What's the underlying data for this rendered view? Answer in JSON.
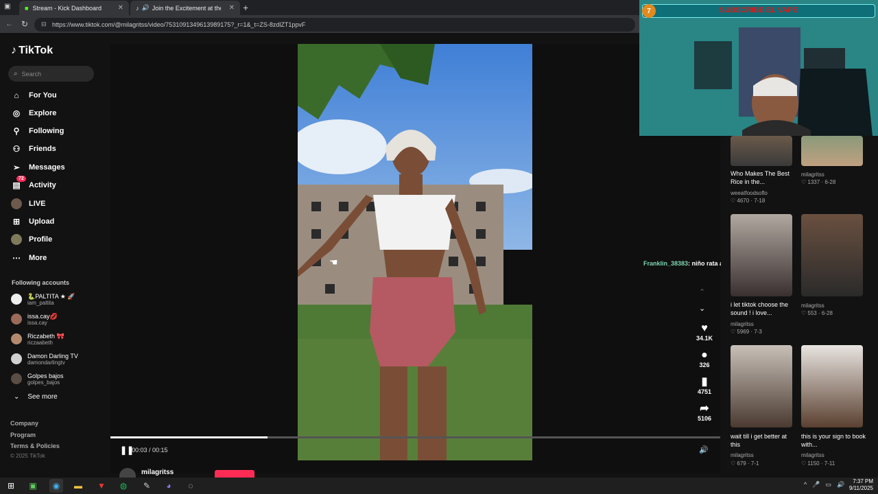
{
  "browser": {
    "tabs": [
      {
        "title": "Stream - Kick Dashboard"
      },
      {
        "title": "Join the Excitement at the D"
      }
    ],
    "url": "https://www.tiktok.com/@milagritss/video/7531091349613989175?_r=1&_t=ZS-8zdlZT1ppvF"
  },
  "sidebar": {
    "logo": "TikTok",
    "search_placeholder": "Search",
    "nav": [
      {
        "label": "For You",
        "icon": "home-icon"
      },
      {
        "label": "Explore",
        "icon": "compass-icon"
      },
      {
        "label": "Following",
        "icon": "following-icon"
      },
      {
        "label": "Friends",
        "icon": "friends-icon"
      },
      {
        "label": "Messages",
        "icon": "send-icon"
      },
      {
        "label": "Activity",
        "icon": "activity-icon",
        "badge": "72"
      },
      {
        "label": "LIVE",
        "icon": "live-icon"
      },
      {
        "label": "Upload",
        "icon": "upload-icon"
      },
      {
        "label": "Profile",
        "icon": "profile-icon"
      },
      {
        "label": "More",
        "icon": "more-icon"
      }
    ],
    "following_title": "Following accounts",
    "accounts": [
      {
        "name": "🐍PALTITA ★ 🚀",
        "handle": "iam_paltita"
      },
      {
        "name": "issa.cay💋",
        "handle": "issa.cay"
      },
      {
        "name": "Riczabeth 🎀",
        "handle": "riczaabeth"
      },
      {
        "name": "Damon Darling TV",
        "handle": "damondarlingtv"
      },
      {
        "name": "Golpes bajos",
        "handle": "golpes_bajos"
      }
    ],
    "see_more": "See more",
    "footer": [
      "Company",
      "Program",
      "Terms & Policies"
    ],
    "copyright": "© 2025 TikTok"
  },
  "player": {
    "time": "00:03 / 00:15",
    "progress": 0.2,
    "author": "milagritss",
    "actions": [
      {
        "icon": "heart-icon",
        "count": "34.1K"
      },
      {
        "icon": "comment-icon",
        "count": "326"
      },
      {
        "icon": "bookmark-icon",
        "count": "4751"
      },
      {
        "icon": "share-icon",
        "count": "5106"
      }
    ]
  },
  "chat_overlay": {
    "user": "Franklin_38383",
    "message": ": niño rata al fin"
  },
  "webcam": {
    "banner": "SUBSCRIBE EL VAPE",
    "badge": "7"
  },
  "related": [
    {
      "caption": "Who Makes The Best Rice in the...",
      "author": "weeatfoodsoflo",
      "likes": "4670",
      "date": "7-18"
    },
    {
      "caption": "",
      "author": "milagritss",
      "likes": "1337",
      "date": "6-28"
    },
    {
      "caption": "i let tiktok choose the sound ! i love...",
      "author": "milagritss",
      "likes": "5969",
      "date": "7-3"
    },
    {
      "caption": "",
      "author": "milagritss",
      "likes": "553",
      "date": "6-28"
    },
    {
      "caption": "wait till i get better at this",
      "author": "milagritss",
      "likes": "679",
      "date": "7-1"
    },
    {
      "caption": "this is your sign to book with...",
      "author": "milagritss",
      "likes": "1150",
      "date": "7-11"
    }
  ],
  "taskbar": {
    "time": "7:37 PM",
    "date": "9/11/2025"
  }
}
